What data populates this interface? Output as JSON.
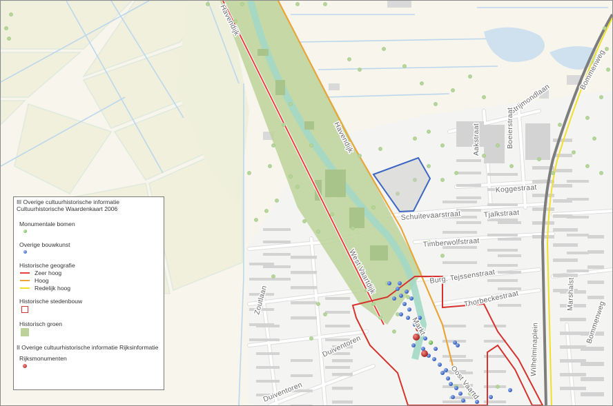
{
  "map": {
    "colors": {
      "land": "#f7f5ec",
      "water": "#cfe1ee",
      "water_line": "#9ec8e6",
      "road": "#ffffff",
      "road_edge": "#d8d8d8",
      "building": "#d4d4d4",
      "zeer_hoog": "#e8413c",
      "hoog": "#e9a53a",
      "redelijk_hoog": "#f0e02a",
      "historisch_groen": "#bcd29a",
      "stedenbouw": "#d6312c",
      "bouwkunst": "#3f6fd0",
      "monumentaal": "#7ac95a",
      "rijksmonument": "#c9302c",
      "selection": "#3d66c2",
      "railway": "#7d7d7d"
    },
    "street_labels": {
      "havendijk_n": "Havendijk",
      "havendijk_s": "Havendijk",
      "west_vaartdijk": "West Vaartdijk",
      "strijmond": "Strijmondlaan",
      "boeier": "Boeierstraat",
      "aak": "Aakstraat",
      "kogge": "Koggestraat",
      "schuitevaar": "Schuitevaarstraat",
      "tjalk": "Tjalkstraat",
      "timberwolf": "Timberwolfstraat",
      "tejssen": "Burg. Tejssenstraat",
      "thorbecke": "Thorbeckestraat",
      "zout": "Zoutlaan",
      "duiventoren_1": "Duiventoren",
      "duiventoren_2": "Duiventoren",
      "wilhelmina": "Wilhelminaplein",
      "marshal": "Marshalst",
      "bommen_n": "Bommenweg",
      "bommen_s": "Bommenweg",
      "oost_vaart": "Oost Vaartd",
      "markt": "Markt"
    }
  },
  "legend": {
    "header_line1": "III Overige cultuurhistorische informatie",
    "header_line2": "Cultuurhistorische Waardenkaart 2006",
    "items": [
      {
        "group": "Monumentale bomen"
      },
      {
        "group": "Overige bouwkunst"
      },
      {
        "group": "Historische geografie",
        "rows": [
          "Zeer hoog",
          "Hoog",
          "Redelijk hoog"
        ]
      },
      {
        "group": "Historische stedenbouw"
      },
      {
        "group": "Historisch groen"
      }
    ],
    "section2_title": "II Overige cultuurhistorische informatie Rijksinformatie",
    "section2_group": "Rijksmonumenten",
    "symbols": {
      "monumentale_bomen": "green-dot-icon",
      "overige_bouwkunst": "blue-dot-icon",
      "historische_stedenbouw": "red-outline-square-icon",
      "historisch_groen": "green-fill-square-icon",
      "rijksmonumenten": "red-dot-icon"
    }
  }
}
